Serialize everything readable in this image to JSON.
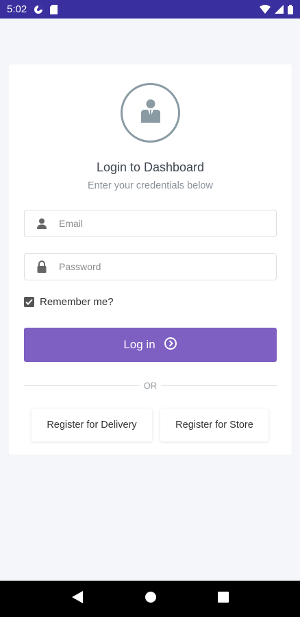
{
  "status_bar": {
    "time": "5:02",
    "left_icons": [
      "data-saver-icon",
      "sim-card-icon"
    ],
    "right_icons": [
      "wifi-icon",
      "signal-icon",
      "battery-icon"
    ]
  },
  "login": {
    "avatar_icon": "user-tie-icon",
    "title": "Login to Dashboard",
    "subtitle": "Enter your credentials below",
    "email": {
      "placeholder": "Email",
      "value": "",
      "icon": "user-icon"
    },
    "password": {
      "placeholder": "Password",
      "value": "",
      "icon": "lock-icon"
    },
    "remember": {
      "label": "Remember me?",
      "checked": true
    },
    "login_button": {
      "label": "Log in",
      "icon": "arrow-circle-right-icon"
    },
    "or_text": "OR",
    "register_delivery": "Register for Delivery",
    "register_store": "Register for Store"
  },
  "colors": {
    "status_bar": "#3a2f9e",
    "accent": "#7e5fc2",
    "background": "#f4f6f9"
  },
  "nav_bar": {
    "buttons": [
      "back-icon",
      "home-icon",
      "recents-icon"
    ]
  }
}
